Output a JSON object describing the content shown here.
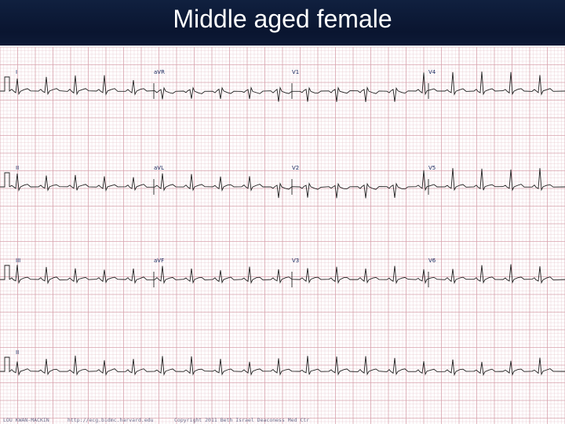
{
  "title": "Middle aged female",
  "ecg": {
    "grid_minor_color": "#e8c9cf",
    "grid_major_color": "#d7a2ad",
    "trace_color": "#222222",
    "rows": [
      {
        "leads": [
          "I",
          "aVR",
          "V1",
          "V4"
        ]
      },
      {
        "leads": [
          "II",
          "aVL",
          "V2",
          "V5"
        ]
      },
      {
        "leads": [
          "III",
          "aVF",
          "V3",
          "V6"
        ]
      },
      {
        "leads": [
          "II"
        ]
      }
    ]
  },
  "footer": {
    "left": "LOU KWAN-MACKIN",
    "middle": "http://ecg.bidmc.harvard.edu",
    "right": "Copyright 2011 Beth Israel Deaconess Med Ctr"
  }
}
